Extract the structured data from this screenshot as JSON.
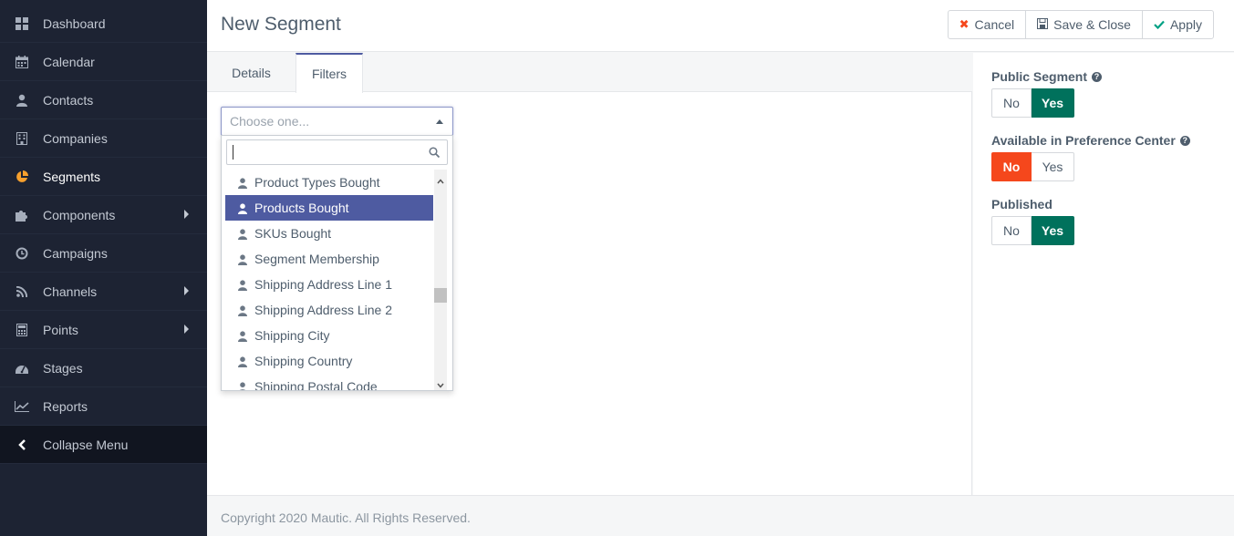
{
  "sidebar": {
    "items": [
      {
        "label": "Dashboard",
        "icon": "grid-icon"
      },
      {
        "label": "Calendar",
        "icon": "calendar-icon"
      },
      {
        "label": "Contacts",
        "icon": "user-icon"
      },
      {
        "label": "Companies",
        "icon": "building-icon"
      },
      {
        "label": "Segments",
        "icon": "pie-chart-icon",
        "active": true
      },
      {
        "label": "Components",
        "icon": "puzzle-icon",
        "submenu": true
      },
      {
        "label": "Campaigns",
        "icon": "clock-icon"
      },
      {
        "label": "Channels",
        "icon": "rss-icon",
        "submenu": true
      },
      {
        "label": "Points",
        "icon": "calculator-icon",
        "submenu": true
      },
      {
        "label": "Stages",
        "icon": "tachometer-icon"
      },
      {
        "label": "Reports",
        "icon": "line-chart-icon"
      },
      {
        "label": "Collapse Menu",
        "icon": "chevron-left-icon"
      }
    ]
  },
  "header": {
    "title": "New Segment",
    "buttons": {
      "cancel": "Cancel",
      "save_close": "Save & Close",
      "apply": "Apply"
    }
  },
  "tabs": {
    "details": "Details",
    "filters": "Filters"
  },
  "filter": {
    "placeholder": "Choose one...",
    "search_value": "",
    "options": [
      "Product Types Bought",
      "Products Bought",
      "SKUs Bought",
      "Segment Membership",
      "Shipping Address Line 1",
      "Shipping Address Line 2",
      "Shipping City",
      "Shipping Country",
      "Shipping Postal Code"
    ],
    "highlighted": "Products Bought"
  },
  "settings": {
    "public_segment": {
      "label": "Public Segment",
      "no": "No",
      "yes": "Yes",
      "value": "Yes"
    },
    "preference_center": {
      "label": "Available in Preference Center",
      "no": "No",
      "yes": "Yes",
      "value": "No"
    },
    "published": {
      "label": "Published",
      "no": "No",
      "yes": "Yes",
      "value": "Yes"
    }
  },
  "colors": {
    "sidebar_bg": "#1d2333",
    "accent": "#4e5ba1",
    "yes_green": "#00715c",
    "no_red": "#f5471c"
  },
  "footer": {
    "copyright": "Copyright 2020 Mautic. All Rights Reserved."
  }
}
